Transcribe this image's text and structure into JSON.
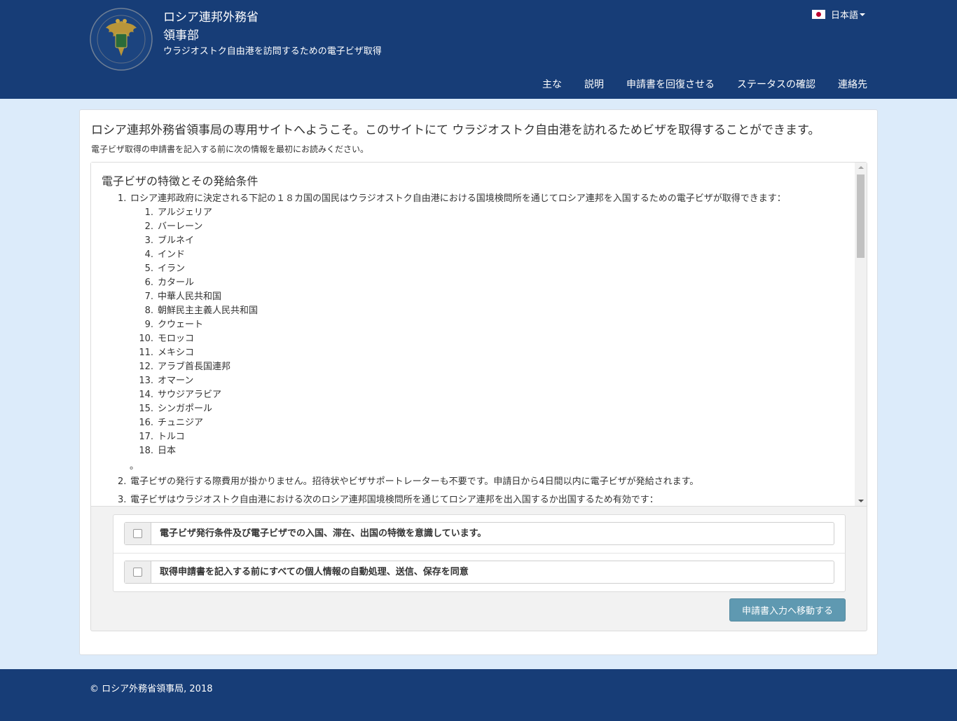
{
  "header": {
    "title_line1": "ロシア連邦外務省",
    "title_line2": "領事部",
    "subtitle": "ウラジオストク自由港を訪問するための電子ビザ取得",
    "language": "日本語",
    "nav": [
      "主な",
      "説明",
      "申請書を回復させる",
      "ステータスの確認",
      "連絡先"
    ]
  },
  "main": {
    "welcome": "ロシア連邦外務省領事局の専用サイトへようこそ。このサイトにて ウラジオストク自由港を訪れるためビザを取得することができます。",
    "read_first": "電子ビザ取得の申請書を記入する前に次の情報を最初にお読みください。",
    "section_title": "電子ビザの特徴とその発給条件",
    "items": [
      {
        "num": "1.",
        "text": "ロシア連邦政府に決定される下記の１８カ国の国民はウラジオストク自由港における国境検問所を通じてロシア連邦を入国するための電子ビザが取得できます："
      },
      {
        "num": "2.",
        "text": "電子ビザの発行する際費用が掛かりません。招待状やビザサポートレーターも不要です。申請日から4日間以内に電子ビザが発給されます。"
      },
      {
        "num": "3.",
        "text": "電子ビザはウラジオストク自由港における次のロシア連邦国境検問所を通じてロシア連邦を出入国するか出国するため有効です："
      }
    ],
    "countries": [
      {
        "num": "1.",
        "name": "アルジェリア"
      },
      {
        "num": "2.",
        "name": "バーレーン"
      },
      {
        "num": "3.",
        "name": "ブルネイ"
      },
      {
        "num": "4.",
        "name": "インド"
      },
      {
        "num": "5.",
        "name": "イラン"
      },
      {
        "num": "6.",
        "name": "カタール"
      },
      {
        "num": "7.",
        "name": "中華人民共和国"
      },
      {
        "num": "8.",
        "name": "朝鮮民主主義人民共和国"
      },
      {
        "num": "9.",
        "name": "クウェート"
      },
      {
        "num": "10.",
        "name": "モロッコ"
      },
      {
        "num": "11.",
        "name": "メキシコ"
      },
      {
        "num": "12.",
        "name": "アラブ首長国連邦"
      },
      {
        "num": "13.",
        "name": "オマーン"
      },
      {
        "num": "14.",
        "name": "サウジアラビア"
      },
      {
        "num": "15.",
        "name": "シンガポール"
      },
      {
        "num": "16.",
        "name": "チュニジア"
      },
      {
        "num": "17.",
        "name": "トルコ"
      },
      {
        "num": "18.",
        "name": "日本"
      }
    ],
    "list_end": "。",
    "checkbox1_label": "電子ビザ発行条件及び電子ビザでの入国、滞在、出国の特徴を意識しています。",
    "checkbox2_label": "取得申請書を記入する前にすべての個人情報の自動処理、送信、保存を同意",
    "proceed_button": "申請書入力へ移動する"
  },
  "footer": {
    "copyright": "© ロシア外務省領事局, 2018"
  },
  "colors": {
    "header_bg": "#173d77",
    "page_bg": "#dcebfa",
    "button_bg": "#5f99b1",
    "flag_red": "#bc002d"
  },
  "icons": [
    "emblem-logo",
    "japan-flag-icon",
    "caret-down-icon",
    "scroll-up-icon",
    "scroll-down-icon"
  ]
}
